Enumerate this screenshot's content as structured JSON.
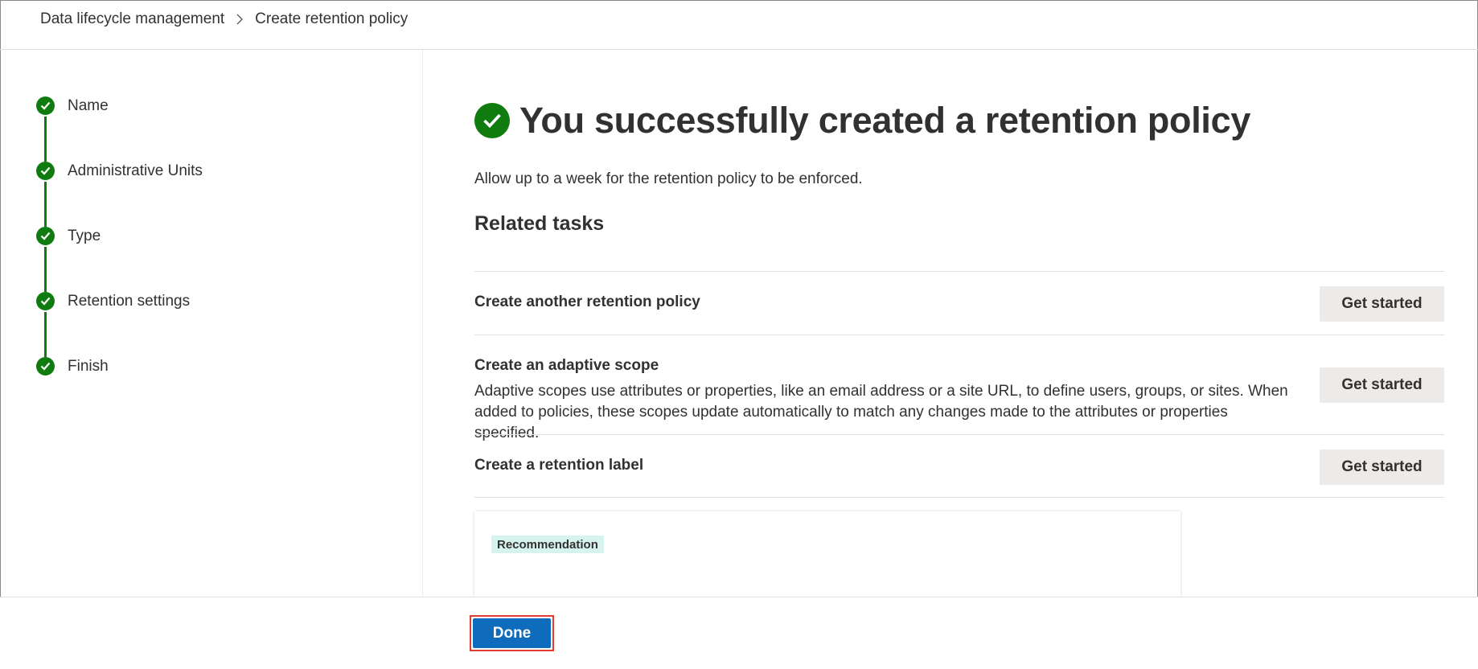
{
  "breadcrumb": {
    "parent": "Data lifecycle management",
    "current": "Create retention policy"
  },
  "steps": [
    {
      "label": "Name",
      "status": "completed"
    },
    {
      "label": "Administrative Units",
      "status": "completed"
    },
    {
      "label": "Type",
      "status": "completed"
    },
    {
      "label": "Retention settings",
      "status": "completed"
    },
    {
      "label": "Finish",
      "status": "completed"
    }
  ],
  "main": {
    "title": "You successfully created a retention policy",
    "subtitle": "Allow up to a week for the retention policy to be enforced.",
    "related_heading": "Related tasks",
    "tasks": [
      {
        "title": "Create another retention policy",
        "description": "",
        "button": "Get started"
      },
      {
        "title": "Create an adaptive scope",
        "description": "Adaptive scopes use attributes or properties, like an email address or a site URL, to define users, groups, or sites. When added to policies, these scopes update automatically to match any changes made to the attributes or properties specified.",
        "button": "Get started"
      },
      {
        "title": "Create a retention label",
        "description": "",
        "button": "Get started"
      }
    ],
    "recommendation_badge": "Recommendation"
  },
  "footer": {
    "done_label": "Done"
  },
  "colors": {
    "success_green": "#107c10",
    "primary_blue": "#0f6cbd",
    "highlight_red": "#e03c31",
    "badge_bg": "#d7f3ee"
  }
}
